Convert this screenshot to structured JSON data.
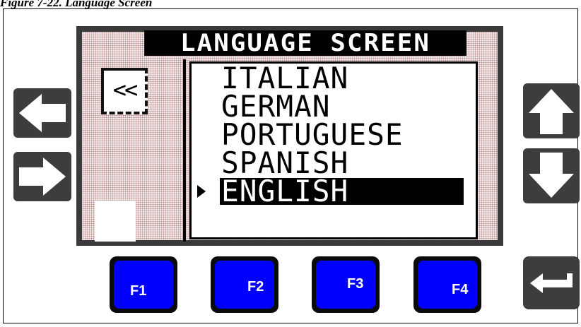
{
  "figure_caption": "Figure 7-22. Language Screen",
  "screen": {
    "title": "LANGUAGE SCREEN",
    "back_label": "<<",
    "languages": [
      "ITALIAN",
      "GERMAN",
      "PORTUGUESE",
      "SPANISH",
      "ENGLISH"
    ],
    "selected": "ENGLISH"
  },
  "keys": {
    "left": "left-arrow-icon",
    "right": "right-arrow-icon",
    "up": "up-arrow-icon",
    "down": "down-arrow-icon",
    "enter": "enter-icon",
    "f1": "F1",
    "f2": "F2",
    "f3": "F3",
    "f4": "F4"
  },
  "colors": {
    "function_key": "#0000ff",
    "nav_key": "#3d3d3d",
    "lcd_bezel": "#3a3a3a",
    "lcd_dots": "#b88a8a"
  }
}
